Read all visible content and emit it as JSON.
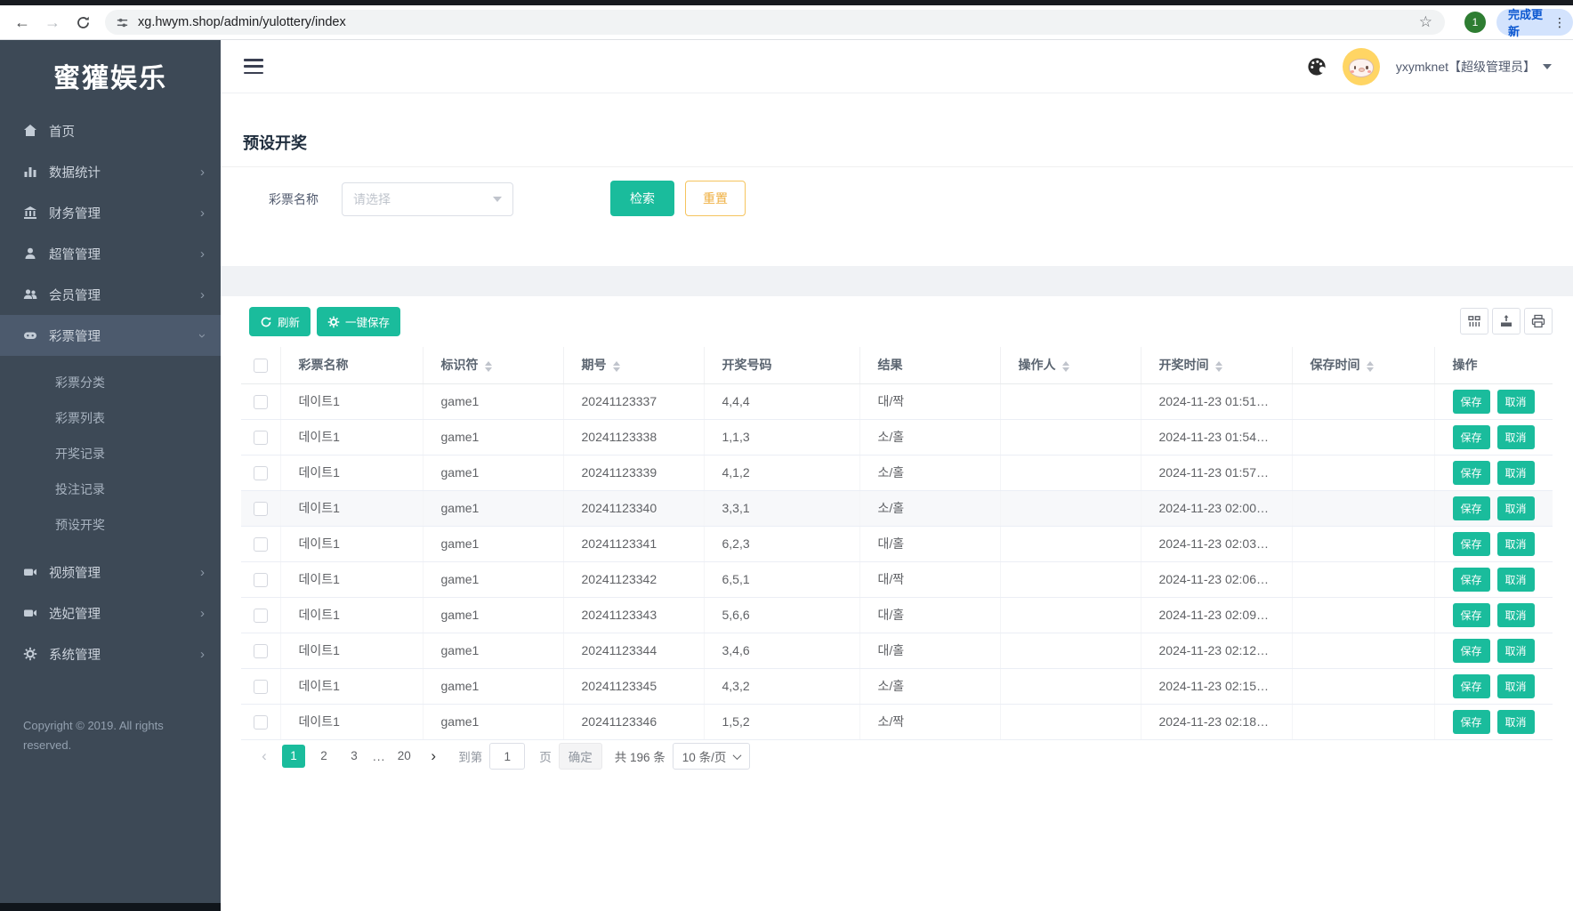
{
  "browser": {
    "url": "xg.hwym.shop/admin/yulottery/index",
    "profile_badge": "1",
    "update_button_label": "完成更新"
  },
  "sidebar": {
    "logo": "蜜獾娱乐",
    "items": [
      {
        "label": "首页"
      },
      {
        "label": "数据统计"
      },
      {
        "label": "财务管理"
      },
      {
        "label": "超管管理"
      },
      {
        "label": "会员管理"
      },
      {
        "label": "彩票管理"
      },
      {
        "label": "视频管理"
      },
      {
        "label": "选妃管理"
      },
      {
        "label": "系统管理"
      }
    ],
    "lottery_submenu": [
      {
        "label": "彩票分类"
      },
      {
        "label": "彩票列表"
      },
      {
        "label": "开奖记录"
      },
      {
        "label": "投注记录"
      },
      {
        "label": "预设开奖"
      }
    ],
    "copyright_line1": "Copyright © 2019. All rights",
    "copyright_line2": "reserved."
  },
  "header": {
    "username": "yxymknet【超级管理员】"
  },
  "page": {
    "title": "预设开奖"
  },
  "filter": {
    "label": "彩票名称",
    "select_placeholder": "请选择",
    "search_label": "检索",
    "reset_label": "重置"
  },
  "toolbar": {
    "refresh_label": "刷新",
    "save_all_label": "一键保存"
  },
  "table": {
    "columns": [
      {
        "label": "彩票名称"
      },
      {
        "label": "标识符"
      },
      {
        "label": "期号"
      },
      {
        "label": "开奖号码"
      },
      {
        "label": "结果"
      },
      {
        "label": "操作人"
      },
      {
        "label": "开奖时间"
      },
      {
        "label": "保存时间"
      },
      {
        "label": "操作"
      }
    ],
    "row_actions": {
      "save": "保存",
      "cancel": "取消"
    },
    "rows": [
      {
        "name": "데이트1",
        "code": "game1",
        "issue": "20241123337",
        "numbers": "4,4,4",
        "result": "대/짝",
        "operator": "",
        "draw_time": "2024-11-23 01:51…",
        "save_time": ""
      },
      {
        "name": "데이트1",
        "code": "game1",
        "issue": "20241123338",
        "numbers": "1,1,3",
        "result": "소/홀",
        "operator": "",
        "draw_time": "2024-11-23 01:54…",
        "save_time": ""
      },
      {
        "name": "데이트1",
        "code": "game1",
        "issue": "20241123339",
        "numbers": "4,1,2",
        "result": "소/홀",
        "operator": "",
        "draw_time": "2024-11-23 01:57…",
        "save_time": ""
      },
      {
        "name": "데이트1",
        "code": "game1",
        "issue": "20241123340",
        "numbers": "3,3,1",
        "result": "소/홀",
        "operator": "",
        "draw_time": "2024-11-23 02:00…",
        "save_time": ""
      },
      {
        "name": "데이트1",
        "code": "game1",
        "issue": "20241123341",
        "numbers": "6,2,3",
        "result": "대/홀",
        "operator": "",
        "draw_time": "2024-11-23 02:03…",
        "save_time": ""
      },
      {
        "name": "데이트1",
        "code": "game1",
        "issue": "20241123342",
        "numbers": "6,5,1",
        "result": "대/짝",
        "operator": "",
        "draw_time": "2024-11-23 02:06…",
        "save_time": ""
      },
      {
        "name": "데이트1",
        "code": "game1",
        "issue": "20241123343",
        "numbers": "5,6,6",
        "result": "대/홀",
        "operator": "",
        "draw_time": "2024-11-23 02:09…",
        "save_time": ""
      },
      {
        "name": "데이트1",
        "code": "game1",
        "issue": "20241123344",
        "numbers": "3,4,6",
        "result": "대/홀",
        "operator": "",
        "draw_time": "2024-11-23 02:12…",
        "save_time": ""
      },
      {
        "name": "데이트1",
        "code": "game1",
        "issue": "20241123345",
        "numbers": "4,3,2",
        "result": "소/홀",
        "operator": "",
        "draw_time": "2024-11-23 02:15…",
        "save_time": ""
      },
      {
        "name": "데이트1",
        "code": "game1",
        "issue": "20241123346",
        "numbers": "1,5,2",
        "result": "소/짝",
        "operator": "",
        "draw_time": "2024-11-23 02:18…",
        "save_time": ""
      }
    ]
  },
  "pagination": {
    "prev": "‹",
    "next": "›",
    "pages": [
      "1",
      "2",
      "3",
      "...",
      "20"
    ],
    "goto_label": "到第",
    "goto_value": "1",
    "goto_unit": "页",
    "confirm_label": "确定",
    "total_label": "共 196 条",
    "page_size_label": "10 条/页"
  },
  "colors": {
    "accent_teal": "#1abc9c",
    "reset_border": "#f5c45e",
    "reset_text": "#efaf41",
    "number_red": "#f23c3c",
    "sidebar_bg": "#3d4956"
  }
}
